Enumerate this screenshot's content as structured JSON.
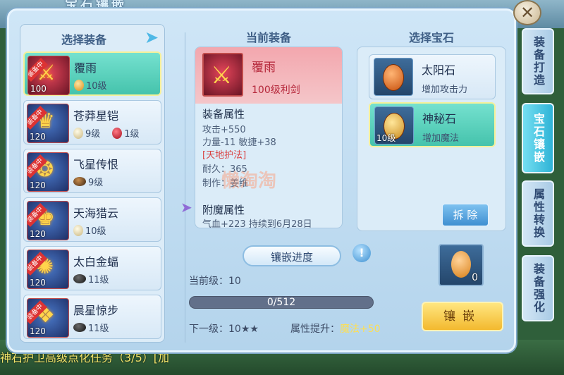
{
  "top_title": "宝石镶嵌",
  "left": {
    "title": "选择装备",
    "items": [
      {
        "name": "覆雨",
        "level": "100",
        "badge": "装备中",
        "gem_level": "10级",
        "gem2_level": "",
        "selected": true
      },
      {
        "name": "苍莽星铠",
        "level": "120",
        "badge": "装备中",
        "gem_level": "9级",
        "gem2_level": "1级",
        "selected": false
      },
      {
        "name": "飞星传恨",
        "level": "120",
        "badge": "装备中",
        "gem_level": "9级",
        "gem2_level": "",
        "selected": false
      },
      {
        "name": "天海猎云",
        "level": "120",
        "badge": "装备中",
        "gem_level": "10级",
        "gem2_level": "",
        "selected": false
      },
      {
        "name": "太白金蝠",
        "level": "120",
        "badge": "装备中",
        "gem_level": "11级",
        "gem2_level": "",
        "selected": false
      },
      {
        "name": "晨星惊步",
        "level": "120",
        "badge": "装备中",
        "gem_level": "11级",
        "gem2_level": "",
        "selected": false
      }
    ]
  },
  "center": {
    "title": "当前装备",
    "name": "覆雨",
    "subtitle": "100级利剑",
    "attr_title": "装备属性",
    "attrs": [
      "攻击+550",
      "力量-11 敏捷+38",
      "[天地护法]",
      "耐久：365",
      "制作：姜维"
    ],
    "magic_title": "附魔属性",
    "magic_line": "气血+223 持续到6月28日"
  },
  "right": {
    "title": "选择宝石",
    "gems": [
      {
        "name": "太阳石",
        "desc": "增加攻击力",
        "level": "",
        "selected": false
      },
      {
        "name": "神秘石",
        "desc": "增加魔法",
        "level": "10级",
        "selected": true
      }
    ],
    "remove_label": "拆 除"
  },
  "progress": {
    "label": "镶嵌进度",
    "current_level_label": "当前级：10",
    "bar_text": "0/512",
    "bar_fraction": 0,
    "next_level_label": "下一级：10★★",
    "attr_gain_label": "属性提升：",
    "attr_gain_value": "魔法+50"
  },
  "slot": {
    "count": "0"
  },
  "inlay_label": "镶嵌",
  "side_tabs": [
    "装备打造",
    "宝石镶嵌",
    "属性转换",
    "装备强化"
  ],
  "watermark": "懒淘淘",
  "bottom_quest": "神石护卫高级点化任务（3/5）[加",
  "close_symbol": "✕",
  "colors": {
    "selected": "#45c3ac",
    "accent_gold": "#f3b92f",
    "red_text": "#b5273a"
  }
}
